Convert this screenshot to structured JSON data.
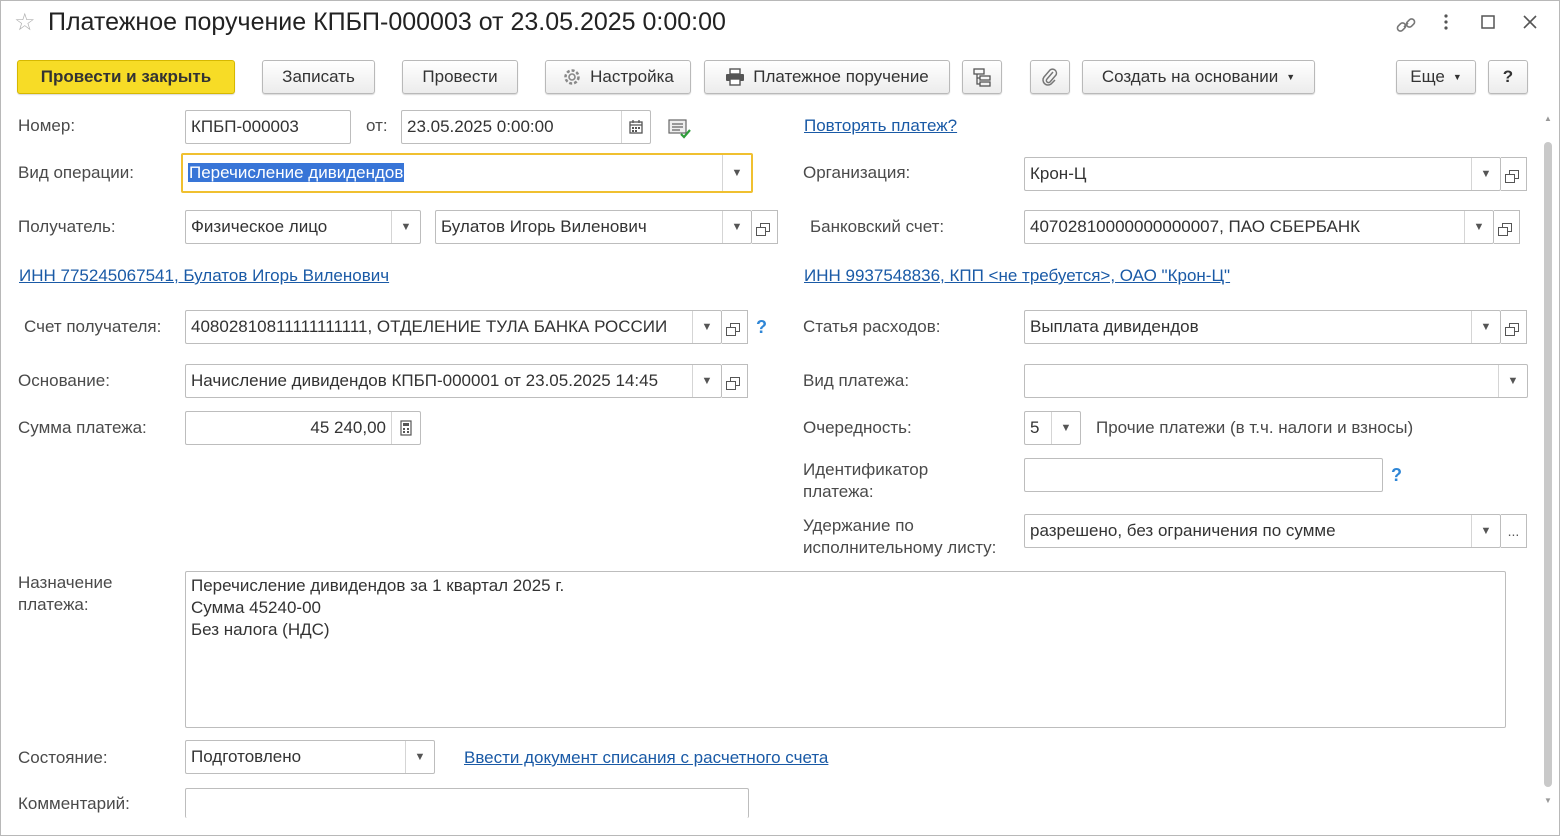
{
  "window": {
    "title": "Платежное поручение КПБП-000003 от 23.05.2025 0:00:00"
  },
  "toolbar": {
    "post_close": "Провести и закрыть",
    "save": "Записать",
    "post": "Провести",
    "settings": "Настройка",
    "print_order": "Платежное поручение",
    "create_based": "Создать на основании",
    "more": "Еще",
    "help": "?"
  },
  "form": {
    "number_label": "Номер:",
    "number_value": "КПБП-000003",
    "from_label": "от:",
    "date_value": "23.05.2025  0:00:00",
    "repeat_link": "Повторять платеж?",
    "op_type_label": "Вид операции:",
    "op_type_value": "Перечисление дивидендов",
    "org_label": "Организация:",
    "org_value": "Крон-Ц",
    "recipient_label": "Получатель:",
    "recipient_type": "Физическое лицо",
    "recipient_name": "Булатов Игорь Виленович",
    "bank_account_label": "Банковский счет:",
    "bank_account_value": "40702810000000000007, ПАО СБЕРБАНК",
    "recipient_inn_link": "ИНН 775245067541, Булатов Игорь Виленович",
    "org_inn_link": "ИНН 9937548836, КПП <не требуется>, ОАО \"Крон-Ц\"",
    "recipient_account_label": "Счет получателя:",
    "recipient_account_value": "40802810811111111111, ОТДЕЛЕНИЕ ТУЛА БАНКА РОССИИ",
    "expense_label": "Статья расходов:",
    "expense_value": "Выплата дивидендов",
    "basis_label": "Основание:",
    "basis_value": "Начисление дивидендов КПБП-000001 от 23.05.2025 14:45",
    "payment_type_label": "Вид платежа:",
    "payment_type_value": "",
    "amount_label": "Сумма платежа:",
    "amount_value": "45 240,00",
    "priority_label": "Очередность:",
    "priority_value": "5",
    "priority_desc": "Прочие платежи (в т.ч. налоги и взносы)",
    "payment_id_label": "Идентификатор платежа:",
    "payment_id_value": "",
    "withholding_label": "Удержание по исполнительному листу:",
    "withholding_value": "разрешено, без ограничения по сумме",
    "purpose_label": "Назначение платежа:",
    "purpose_line1": "Перечисление дивидендов за 1 квартал 2025 г.",
    "purpose_line2": "Сумма 45240-00",
    "purpose_line3": "Без налога (НДС)",
    "status_label": "Состояние:",
    "status_value": "Подготовлено",
    "writeoff_link": "Ввести документ списания с расчетного счета",
    "comment_label": "Комментарий:",
    "comment_value": "",
    "help_mark": "?"
  },
  "colors": {
    "primary_button": "#f7dc26",
    "link": "#1a5aa6",
    "focus_border": "#f0c030",
    "selection": "#3875d7"
  }
}
